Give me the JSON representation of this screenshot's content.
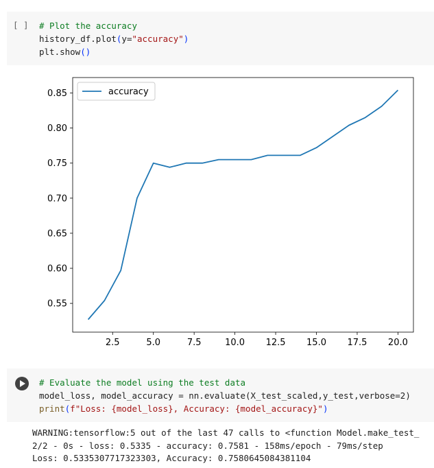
{
  "cell1": {
    "bracket": "[ ]",
    "line1_comment": "# Plot the accuracy",
    "line2_pre": "history_df.plot",
    "line2_open": "(",
    "line2_arg": "y=",
    "line2_str": "\"accuracy\"",
    "line2_close": ")",
    "line3_pre": "plt.show",
    "line3_parens": "()"
  },
  "chart_data": {
    "type": "line",
    "title": "",
    "xlabel": "",
    "ylabel": "",
    "xlim": [
      0.05,
      20.95
    ],
    "ylim": [
      0.509,
      0.872
    ],
    "xticks": [
      "2.5",
      "5.0",
      "7.5",
      "10.0",
      "12.5",
      "15.0",
      "17.5",
      "20.0"
    ],
    "yticks": [
      "0.55",
      "0.60",
      "0.65",
      "0.70",
      "0.75",
      "0.80",
      "0.85"
    ],
    "legend": "top-left",
    "grid": false,
    "series": [
      {
        "name": "accuracy",
        "color": "#1f77b4",
        "x": [
          1,
          2,
          3,
          4,
          5,
          6,
          7,
          8,
          9,
          10,
          11,
          12,
          13,
          14,
          15,
          16,
          17,
          18,
          19,
          20
        ],
        "y": [
          0.527,
          0.554,
          0.597,
          0.7,
          0.75,
          0.744,
          0.75,
          0.75,
          0.755,
          0.755,
          0.755,
          0.761,
          0.761,
          0.761,
          0.772,
          0.788,
          0.804,
          0.815,
          0.831,
          0.854
        ]
      }
    ]
  },
  "cell2": {
    "line1_comment": "# Evaluate the model using the test data",
    "line2": "model_loss, model_accuracy = nn.evaluate(X_test_scaled,y_test,verbose=2)",
    "line3_fn": "print",
    "line3_open": "(",
    "line3_str_a": "f\"Loss: {model_loss}, Accuracy: {model_accuracy}\"",
    "line3_close": ")"
  },
  "output": {
    "line1": "WARNING:tensorflow:5 out of the last 47 calls to <function Model.make_test_",
    "line2": "2/2 - 0s - loss: 0.5335 - accuracy: 0.7581 - 158ms/epoch - 79ms/step",
    "line3": "Loss: 0.5335307717323303, Accuracy: 0.7580645084381104"
  }
}
